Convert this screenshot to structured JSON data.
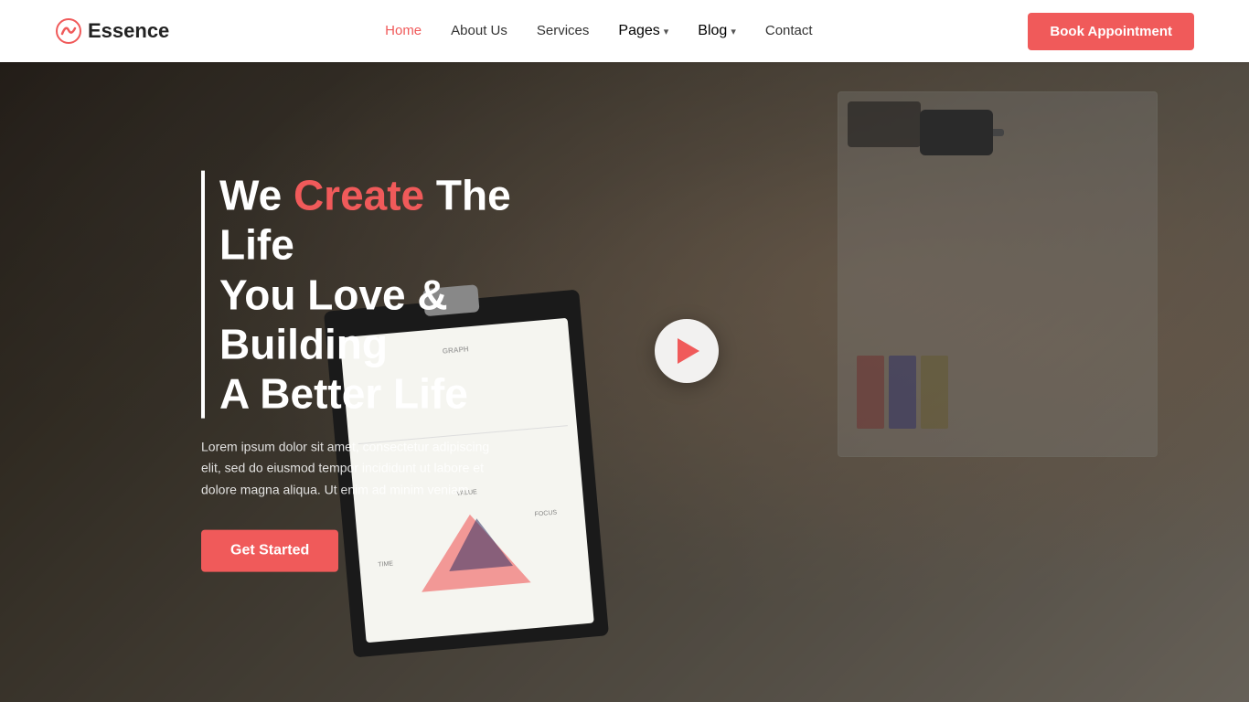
{
  "brand": {
    "name": "Essence",
    "logo_alt": "Essence logo"
  },
  "navbar": {
    "links": [
      {
        "label": "Home",
        "active": true
      },
      {
        "label": "About Us",
        "active": false
      },
      {
        "label": "Services",
        "active": false
      },
      {
        "label": "Pages",
        "active": false,
        "hasArrow": true
      },
      {
        "label": "Blog",
        "active": false,
        "hasArrow": true
      },
      {
        "label": "Contact",
        "active": false
      }
    ],
    "cta_label": "Book Appointment"
  },
  "hero": {
    "title_prefix": "We ",
    "title_highlight": "Create",
    "title_suffix": " The Life",
    "title_line2": "You Love & Building",
    "title_line3": "A Better Life",
    "subtitle": "Lorem ipsum dolor sit amet, consectetur adipiscing elit, sed do eiusmod tempor incididunt ut labore et dolore magna aliqua. Ut enim ad minim veniam",
    "cta_label": "Get Started",
    "play_label": "Play Video"
  },
  "colors": {
    "accent": "#f05a5a",
    "white": "#ffffff",
    "dark": "#222222"
  }
}
